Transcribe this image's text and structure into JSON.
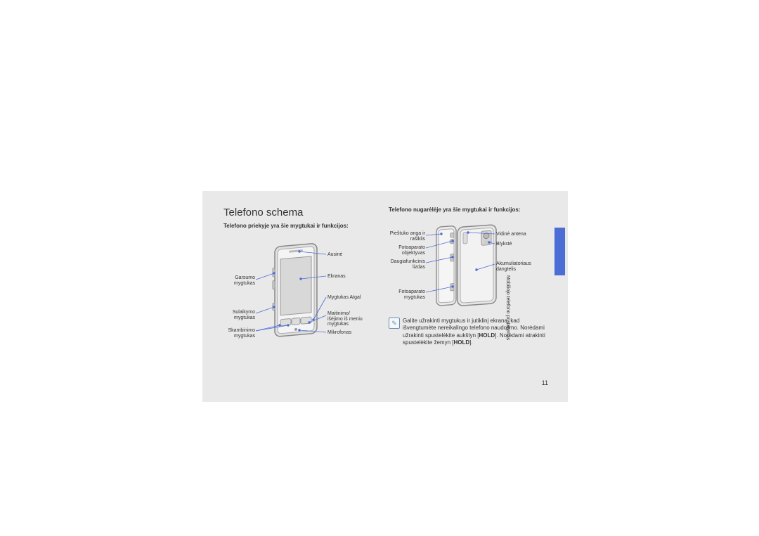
{
  "title": "Telefono schema",
  "front_intro": "Telefono priekyje yra šie mygtukai ir funkcijos:",
  "back_intro": "Telefono nugarėlėje yra šie mygtukai ir funkcijos:",
  "front_labels": {
    "left": {
      "garsumo": "Garsumo\nmygtukas",
      "sulaikymo": "Sulaikymo\nmygtukas",
      "skambinimo": "Skambinimo\nmygtukas"
    },
    "right": {
      "ausine": "Ausinė",
      "ekranas": "Ekranas",
      "atgal": "Mygtukas Atgal",
      "maitinimo": "Maitinimo/\nišėjimo iš meniu\nmygtukas",
      "mikrofonas": "Mikrofonas"
    }
  },
  "back_labels": {
    "left": {
      "piestuko": "Pieštuko anga ir\nrašiklis",
      "foto_obj": "Fotoaparato\nobjektyvas",
      "daugia": "Daugiafunkcinis\nlizdas",
      "foto_mygt": "Fotoaparato\nmygtukas"
    },
    "right": {
      "antena": "Vidinė antena",
      "blykste": "Blykstė",
      "akum": "Akumuliatoriaus\ndangtelis"
    }
  },
  "note": {
    "t1": "Galite užrakinti mygtukus ir jutiklinį ekraną, kad išvengtumėte nereikalingo telefono naudojimo. Norėdami užrakinti spustelėkite aukštyn [",
    "b1": "HOLD",
    "t2": "]. Norėdami atrakinti spustelėkite žemyn [",
    "b2": "HOLD",
    "t3": "]."
  },
  "side_text": "Mobiliojo telefono pristatymas",
  "page_num": "11"
}
